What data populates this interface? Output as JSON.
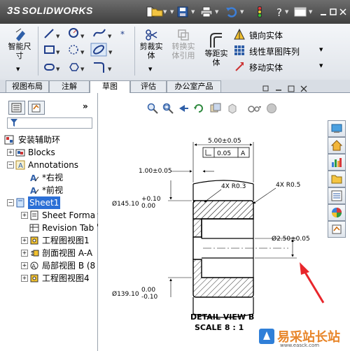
{
  "app": {
    "brand": "SOLIDWORKS",
    "brand_prefix": "3S"
  },
  "toolbar": {
    "icons": [
      "new-document-icon",
      "open-folder-icon",
      "save-icon",
      "print-icon",
      "undo-icon",
      "traffic-light-icon",
      "help-icon",
      "window-icon"
    ]
  },
  "command_manager": {
    "smart_dimension": "智能尺\n寸",
    "trim_entities": "剪裁实\n体",
    "convert_entities": "转换实\n体引用",
    "offset_entities": "等距实\n体",
    "mirror_entities": "镜向实体",
    "linear_pattern": "线性草图阵列",
    "move_entities": "移动实体"
  },
  "tabs": [
    {
      "label": "视图布局",
      "active": false
    },
    {
      "label": "注解",
      "active": false
    },
    {
      "label": "草图",
      "active": true
    },
    {
      "label": "评估",
      "active": false
    },
    {
      "label": "办公室产品",
      "active": false
    }
  ],
  "feature_tree": {
    "root": "安装辅助环",
    "items": [
      {
        "label": "Blocks",
        "indent": 1,
        "icon": "blocks-icon",
        "expander": "+"
      },
      {
        "label": "Annotations",
        "indent": 1,
        "icon": "annotations-icon",
        "expander": "-"
      },
      {
        "label": "*右视",
        "indent": 2,
        "icon": "plane-icon",
        "expander": ""
      },
      {
        "label": "*前视",
        "indent": 2,
        "icon": "plane-icon",
        "expander": ""
      },
      {
        "label": "Sheet1",
        "indent": 1,
        "icon": "sheet-icon",
        "expander": "-",
        "selected": true
      },
      {
        "label": "Sheet Forma",
        "indent": 2,
        "icon": "sheet-format-icon",
        "expander": "+"
      },
      {
        "label": "Revision Tab",
        "indent": 2,
        "icon": "revision-table-icon",
        "expander": ""
      },
      {
        "label": "工程图视图1",
        "indent": 2,
        "icon": "drawing-view-icon",
        "expander": "+"
      },
      {
        "label": "剖面视图 A-A",
        "indent": 2,
        "icon": "section-view-icon",
        "expander": "+"
      },
      {
        "label": "局部视图 B (8",
        "indent": 2,
        "icon": "detail-view-icon",
        "expander": "+"
      },
      {
        "label": "工程图视图4",
        "indent": 2,
        "icon": "drawing-view-icon",
        "expander": "+"
      }
    ]
  },
  "drawing": {
    "dim_width": "5.00±0.05",
    "gdt_value": "0.05",
    "gdt_datum": "A",
    "dim_left_top": "1.00±0.05",
    "dim_dia_top": "Ø145.10",
    "dim_dia_top_tol_upper": "+0.10",
    "dim_dia_top_tol_lower": "0.00",
    "dim_radius_left": "4X R0.3",
    "dim_radius_right": "4X R0.5",
    "dim_dia_bore": "Ø2.50±0.05",
    "dim_dia_bottom": "Ø139.10",
    "dim_dia_bottom_tol_upper": "0.00",
    "dim_dia_bottom_tol_lower": "-0.10",
    "view_title": "DETAIL VIEW B",
    "view_scale": "SCALE 8 : 1"
  },
  "colors": {
    "arrow": "#e8262b",
    "selection": "#2b6fd6"
  },
  "watermark": {
    "text": "易采站长站",
    "url": "www.easck.com"
  }
}
